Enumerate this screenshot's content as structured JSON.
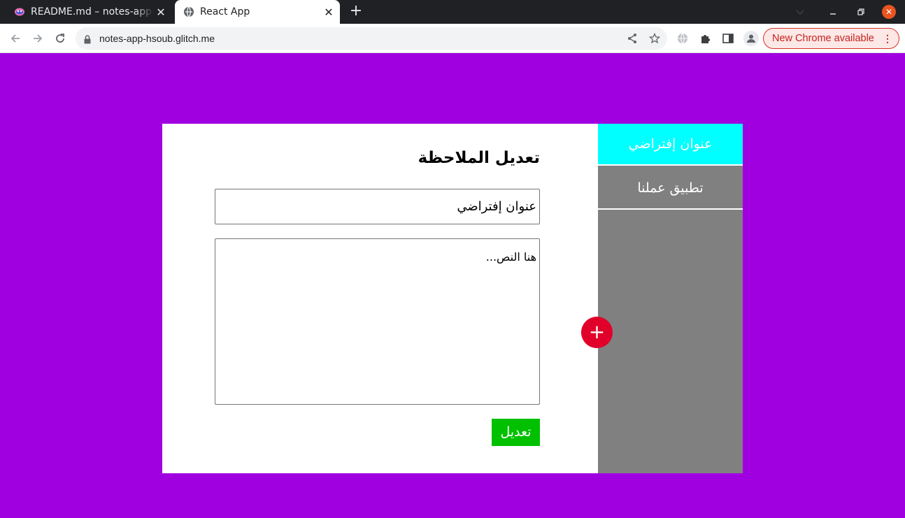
{
  "browser": {
    "tabs": [
      {
        "title": "README.md – notes-app-hsoub",
        "icon": "glitch-favicon",
        "active": false
      },
      {
        "title": "React App",
        "icon": "globe-icon",
        "active": true
      }
    ],
    "url": "notes-app-hsoub.glitch.me",
    "update_label": "New Chrome available"
  },
  "app": {
    "colors": {
      "background": "#a000e0",
      "sidebar": "#808080",
      "active_note": "#00ffff",
      "add_button": "#e0002a",
      "save_button": "#00c000"
    },
    "notes": [
      {
        "title": "عنوان إفتراضي",
        "active": true
      },
      {
        "title": "تطبيق عملنا",
        "active": false
      }
    ],
    "add_button_label": "+",
    "editor": {
      "heading": "تعديل الملاحظة",
      "title_value": "عنوان إفتراضي",
      "body_placeholder": "هنا النص...",
      "save_label": "تعديل"
    }
  }
}
